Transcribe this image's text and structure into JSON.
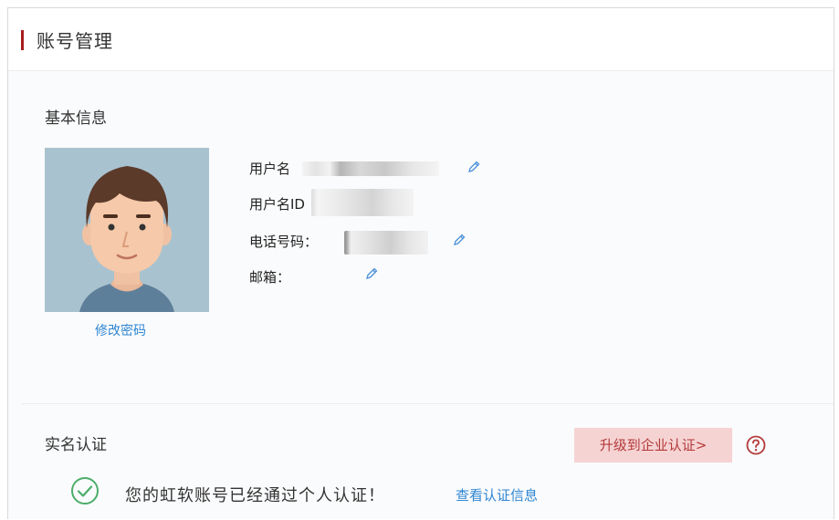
{
  "page": {
    "title": "账号管理"
  },
  "basic_info": {
    "heading": "基本信息",
    "change_password": "修改密码",
    "fields": [
      {
        "label": "用户名",
        "value_visible": false,
        "editable": true
      },
      {
        "label": "用户名ID",
        "value_visible": false,
        "editable": false
      },
      {
        "label": "电话号码：",
        "value_visible": false,
        "editable": true
      },
      {
        "label": "邮箱：",
        "value_visible": false,
        "editable": true
      }
    ],
    "edit_icon": "pencil-icon"
  },
  "verification": {
    "heading": "实名认证",
    "upgrade_button": "升级到企业认证>",
    "help_icon": "question-circle-icon",
    "status_icon": "check-circle-icon",
    "status_message": "您的虹软账号已经通过个人认证！",
    "view_link": "查看认证信息"
  },
  "colors": {
    "accent_red": "#a61c1c",
    "link_blue": "#2f86d3",
    "upgrade_bg": "#f6d3d3",
    "success_green": "#4cae6a"
  }
}
